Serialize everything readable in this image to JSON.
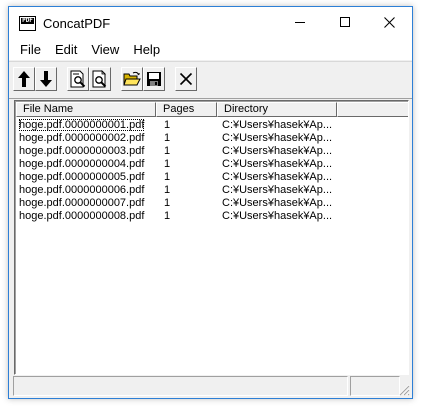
{
  "window": {
    "title": "ConcatPDF",
    "app_icon_text": "PDF"
  },
  "menu": {
    "items": [
      "File",
      "Edit",
      "View",
      "Help"
    ]
  },
  "toolbar": {
    "buttons": [
      {
        "icon": "arrow-up-icon"
      },
      {
        "icon": "arrow-down-icon"
      },
      {
        "icon": "document-search-icon"
      },
      {
        "icon": "document-preview-icon"
      },
      {
        "icon": "open-folder-icon"
      },
      {
        "icon": "save-disk-icon"
      },
      {
        "icon": "delete-x-icon"
      }
    ]
  },
  "list": {
    "columns": [
      "File Name",
      "Pages",
      "Directory"
    ],
    "rows": [
      {
        "name": "hoge.pdf.0000000001.pdf",
        "pages": "1",
        "dir": "C:¥Users¥hasek¥Ap..."
      },
      {
        "name": "hoge.pdf.0000000002.pdf",
        "pages": "1",
        "dir": "C:¥Users¥hasek¥Ap..."
      },
      {
        "name": "hoge.pdf.0000000003.pdf",
        "pages": "1",
        "dir": "C:¥Users¥hasek¥Ap..."
      },
      {
        "name": "hoge.pdf.0000000004.pdf",
        "pages": "1",
        "dir": "C:¥Users¥hasek¥Ap..."
      },
      {
        "name": "hoge.pdf.0000000005.pdf",
        "pages": "1",
        "dir": "C:¥Users¥hasek¥Ap..."
      },
      {
        "name": "hoge.pdf.0000000006.pdf",
        "pages": "1",
        "dir": "C:¥Users¥hasek¥Ap..."
      },
      {
        "name": "hoge.pdf.0000000007.pdf",
        "pages": "1",
        "dir": "C:¥Users¥hasek¥Ap..."
      },
      {
        "name": "hoge.pdf.0000000008.pdf",
        "pages": "1",
        "dir": "C:¥Users¥hasek¥Ap..."
      }
    ]
  },
  "colors": {
    "window_border": "#2d7fd6",
    "face": "#f0f0f0"
  }
}
